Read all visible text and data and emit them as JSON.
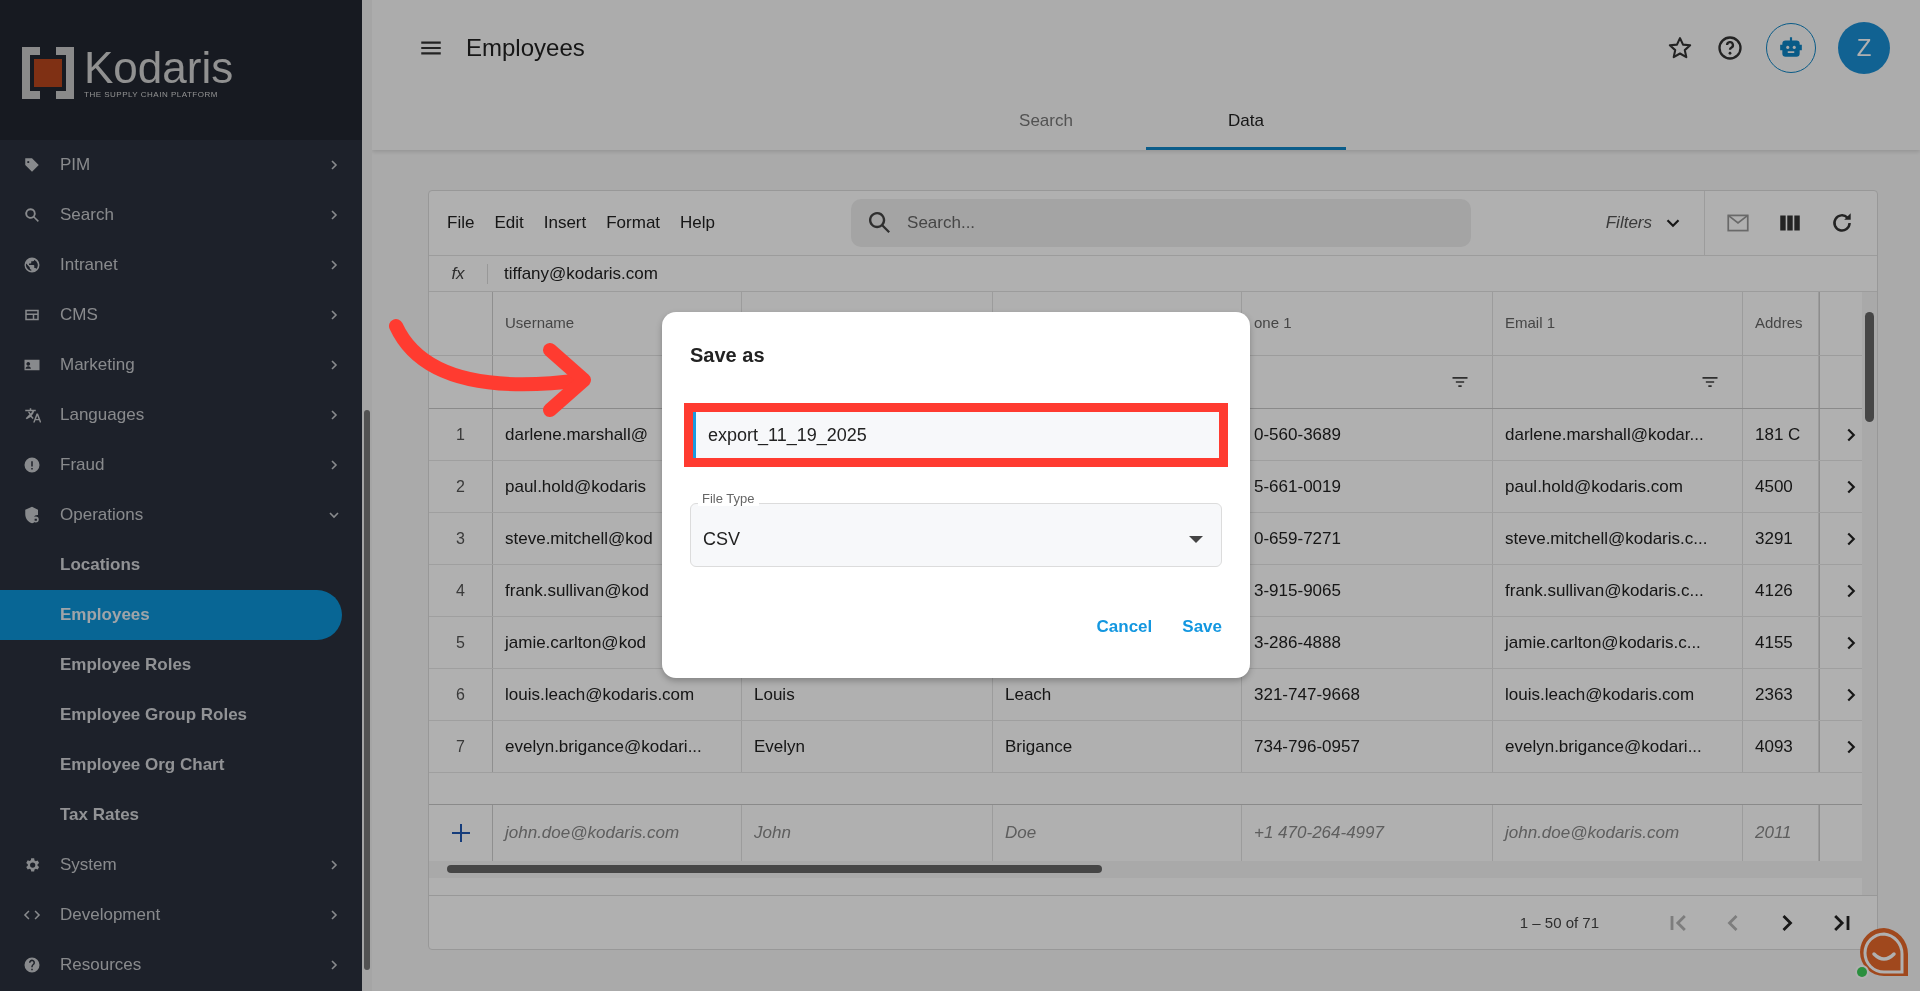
{
  "sidebar": {
    "logo": {
      "name": "Kodaris",
      "tagline": "THE SUPPLY CHAIN PLATFORM"
    },
    "items": [
      {
        "label": "PIM",
        "expanded": false
      },
      {
        "label": "Search",
        "expanded": false
      },
      {
        "label": "Intranet",
        "expanded": false
      },
      {
        "label": "CMS",
        "expanded": false
      },
      {
        "label": "Marketing",
        "expanded": false
      },
      {
        "label": "Languages",
        "expanded": false
      },
      {
        "label": "Fraud",
        "expanded": false
      },
      {
        "label": "Operations",
        "expanded": true,
        "children": [
          {
            "label": "Locations",
            "selected": false
          },
          {
            "label": "Employees",
            "selected": true
          },
          {
            "label": "Employee Roles",
            "selected": false
          },
          {
            "label": "Employee Group Roles",
            "selected": false
          },
          {
            "label": "Employee Org Chart",
            "selected": false
          },
          {
            "label": "Tax Rates",
            "selected": false
          }
        ]
      },
      {
        "label": "System",
        "expanded": false
      },
      {
        "label": "Development",
        "expanded": false
      },
      {
        "label": "Resources",
        "expanded": false
      }
    ]
  },
  "header": {
    "title": "Employees",
    "avatar": "Z"
  },
  "tabs": [
    {
      "label": "Search",
      "selected": false
    },
    {
      "label": "Data",
      "selected": true
    }
  ],
  "toolbar": {
    "menu": [
      "File",
      "Edit",
      "Insert",
      "Format",
      "Help"
    ],
    "search": {
      "placeholder": "Search..."
    },
    "filters": "Filters"
  },
  "formula_bar": {
    "label": "fx",
    "value": "tiffany@kodaris.com"
  },
  "table": {
    "columns": [
      {
        "label": "Username"
      },
      null,
      null,
      {
        "label": "one 1",
        "filterable": true
      },
      {
        "label": "Email 1",
        "filterable": true
      },
      {
        "label": "Addres"
      }
    ],
    "rows": [
      {
        "number": "1",
        "cells": [
          "darlene.marshall@",
          null,
          null,
          "0-560-3689",
          "darlene.marshall@kodar...",
          "181 C"
        ]
      },
      {
        "number": "2",
        "cells": [
          "paul.hold@kodaris",
          null,
          null,
          "5-661-0019",
          "paul.hold@kodaris.com",
          "4500"
        ]
      },
      {
        "number": "3",
        "cells": [
          "steve.mitchell@kod",
          null,
          null,
          "0-659-7271",
          "steve.mitchell@kodaris.c...",
          "3291"
        ]
      },
      {
        "number": "4",
        "cells": [
          "frank.sullivan@kod",
          null,
          null,
          "3-915-9065",
          "frank.sullivan@kodaris.c...",
          "4126"
        ]
      },
      {
        "number": "5",
        "cells": [
          "jamie.carlton@kod",
          null,
          null,
          "3-286-4888",
          "jamie.carlton@kodaris.c...",
          "4155"
        ]
      },
      {
        "number": "6",
        "cells": [
          "louis.leach@kodaris.com",
          "Louis",
          "Leach",
          "321-747-9668",
          "louis.leach@kodaris.com",
          "2363"
        ]
      },
      {
        "number": "7",
        "cells": [
          "evelyn.brigance@kodari...",
          "Evelyn",
          "Brigance",
          "734-796-0957",
          "evelyn.brigance@kodari...",
          "4093"
        ]
      }
    ],
    "new_row": {
      "cells": [
        "john.doe@kodaris.com",
        "John",
        "Doe",
        "+1 470-264-4997",
        "john.doe@kodaris.com",
        "2011"
      ]
    }
  },
  "pager": {
    "range": "1 – 50 of 71",
    "buttons": [
      {
        "disabled": true
      },
      {
        "disabled": true
      },
      {
        "disabled": false
      },
      {
        "disabled": false
      }
    ]
  },
  "dialog": {
    "title": "Save as",
    "filename": "export_11_19_2025",
    "file_type": {
      "label": "File Type",
      "value": "CSV"
    },
    "buttons": [
      "Cancel",
      "Save"
    ]
  }
}
